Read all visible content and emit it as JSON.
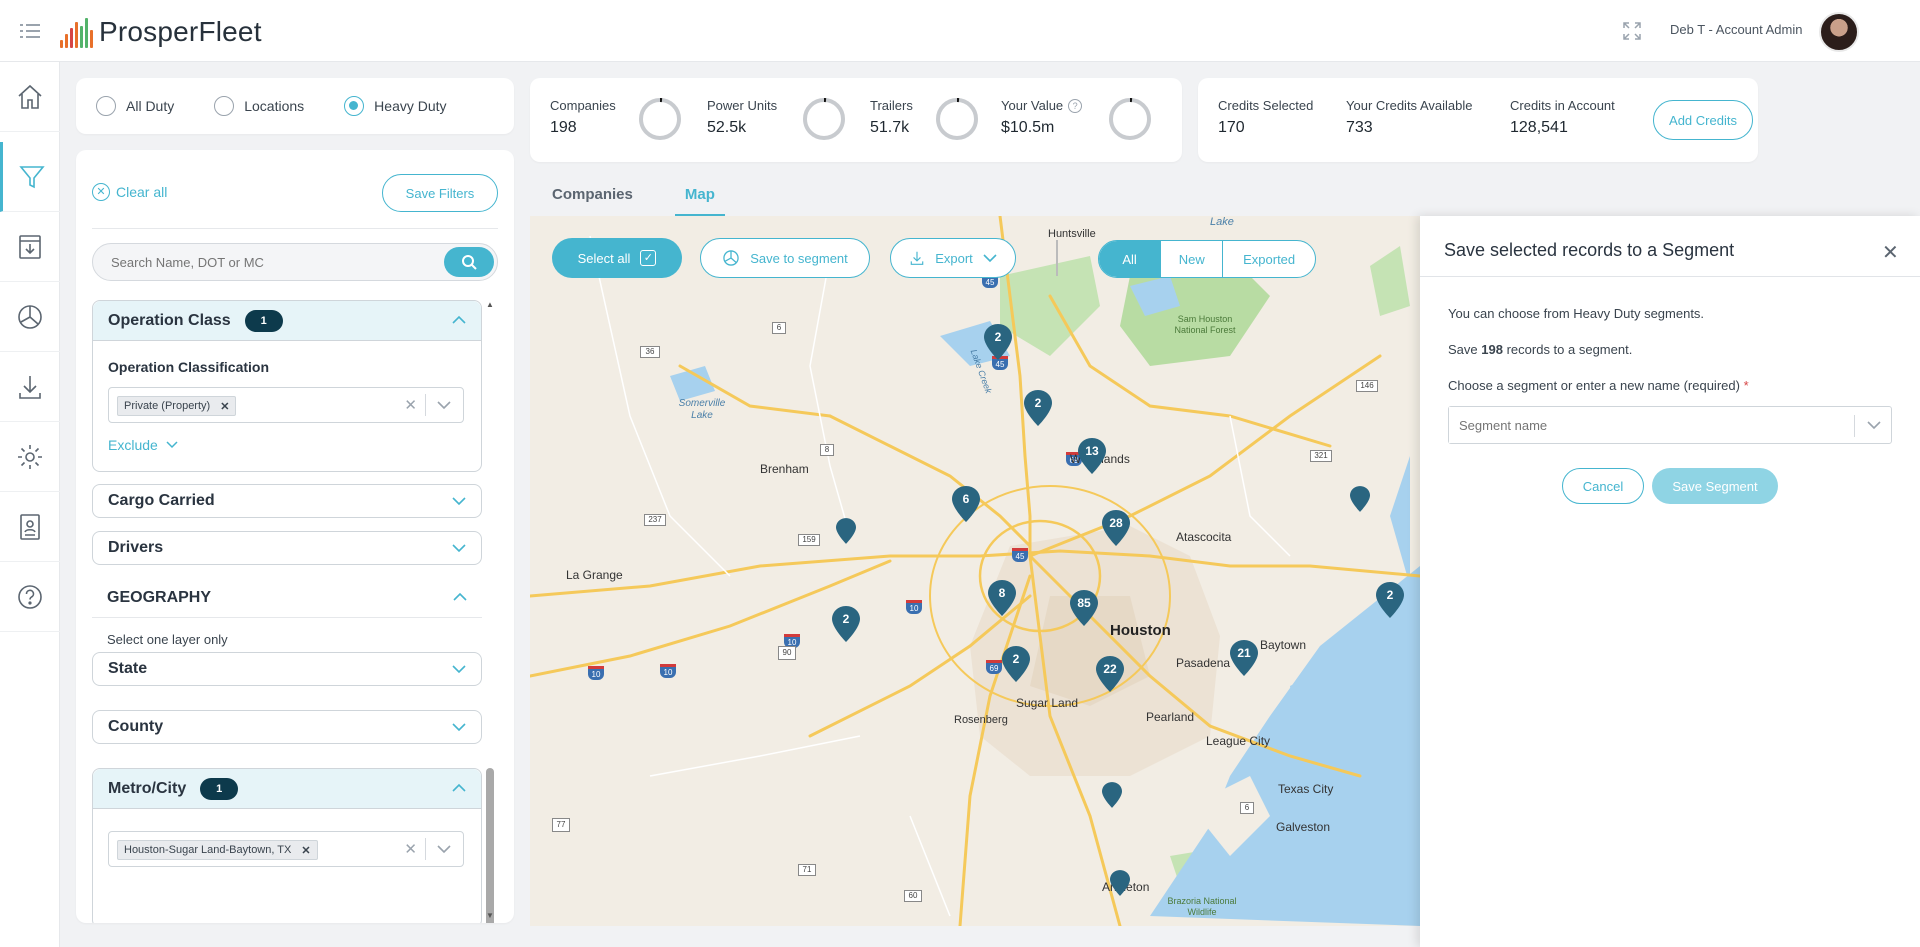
{
  "app": {
    "brand": "ProsperFleet"
  },
  "header": {
    "user": "Deb T - Account Admin"
  },
  "duty": {
    "options": [
      "All Duty",
      "Locations",
      "Heavy Duty"
    ],
    "selected": "Heavy Duty"
  },
  "filters": {
    "clear_all": "Clear all",
    "save_filters": "Save Filters",
    "search_placeholder": "Search Name, DOT or MC",
    "operation_class": {
      "title": "Operation Class",
      "count": "1",
      "sub_label": "Operation Classification",
      "chip": "Private (Property)",
      "exclude": "Exclude"
    },
    "cargo": "Cargo Carried",
    "drivers": "Drivers",
    "geography": {
      "title": "GEOGRAPHY",
      "note": "Select one layer only"
    },
    "state": "State",
    "county": "County",
    "metro": {
      "title": "Metro/City",
      "count": "1",
      "chip": "Houston-Sugar Land-Baytown, TX"
    }
  },
  "stats": [
    {
      "label": "Companies",
      "value": "198"
    },
    {
      "label": "Power Units",
      "value": "52.5k"
    },
    {
      "label": "Trailers",
      "value": "51.7k"
    },
    {
      "label": "Your Value",
      "value": "$10.5m"
    }
  ],
  "credits": [
    {
      "label": "Credits Selected",
      "value": "170"
    },
    {
      "label": "Your Credits Available",
      "value": "733"
    },
    {
      "label": "Credits in Account",
      "value": "128,541"
    }
  ],
  "add_credits": "Add Credits",
  "tabs": [
    "Companies",
    "Map"
  ],
  "active_tab": "Map",
  "map": {
    "select_all": "Select all",
    "save_to_segment": "Save to segment",
    "export": "Export",
    "toggle": [
      "All",
      "New",
      "Exported"
    ],
    "pins": [
      "2",
      "2",
      "13",
      "6",
      "28",
      "8",
      "85",
      "2",
      "2",
      "22",
      "21",
      "2"
    ],
    "cities": [
      "Huntsville",
      "Somerville Lake",
      "Brenham",
      "La Grange",
      "Atascocita",
      "Houston",
      "Baytown",
      "Pasadena",
      "Sugar Land",
      "Rosenberg",
      "Pearland",
      "League City",
      "Texas City",
      "Galveston",
      "Woodlands",
      "Angleton",
      "Lake",
      "Sam Houston National Forest",
      "Lake Creek",
      "Brazoria National Wildlife"
    ],
    "routes": [
      "45",
      "45",
      "69",
      "45",
      "10",
      "10",
      "10",
      "10",
      "69"
    ],
    "shields": [
      "36",
      "6",
      "36",
      "8",
      "237",
      "159",
      "90",
      "146",
      "321",
      "6",
      "71",
      "60",
      "77"
    ]
  },
  "dialog": {
    "title": "Save selected records to a Segment",
    "line1": "You can choose from Heavy Duty segments.",
    "line2_pre": "Save",
    "line2_count": "198",
    "line2_post": "records to a segment.",
    "label": "Choose a segment or enter a new name (required)",
    "required_mark": "*",
    "placeholder": "Segment name",
    "cancel": "Cancel",
    "save": "Save Segment"
  },
  "colors": {
    "accent": "#45b5cf",
    "badge": "#0d3a4c",
    "pin": "#2a6580"
  }
}
